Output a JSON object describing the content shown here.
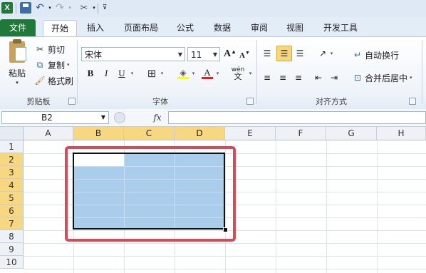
{
  "colors": {
    "file_tab_bg": "#1f7a3a",
    "selection_fill": "#aacdec",
    "selected_header": "#f7d77f",
    "highlight_frame": "#d94a57",
    "font_color_underline": "#e02020",
    "fill_color_underline": "#ffff00"
  },
  "quick_access": {
    "icons": [
      "excel-logo-icon",
      "save-icon",
      "undo-icon",
      "redo-icon",
      "format-painter-icon",
      "customize-icon"
    ],
    "logo_letter": "X"
  },
  "tabs": [
    {
      "label": "文件",
      "active": false
    },
    {
      "label": "开始",
      "active": true
    },
    {
      "label": "插入",
      "active": false
    },
    {
      "label": "页面布局",
      "active": false
    },
    {
      "label": "公式",
      "active": false
    },
    {
      "label": "数据",
      "active": false
    },
    {
      "label": "审阅",
      "active": false
    },
    {
      "label": "视图",
      "active": false
    },
    {
      "label": "开发工具",
      "active": false
    }
  ],
  "ribbon": {
    "clipboard": {
      "paste_label": "粘贴",
      "cut_label": "剪切",
      "copy_label": "复制",
      "format_painter_label": "格式刷",
      "group_label": "剪贴板"
    },
    "font": {
      "font_name": "宋体",
      "font_size": "11",
      "bold": "B",
      "italic": "I",
      "underline": "U",
      "grow_font": "A",
      "shrink_font": "A",
      "font_color_letter": "A",
      "wen_glyph": "wén",
      "group_label": "字体"
    },
    "alignment": {
      "wrap_text_label": "自动换行",
      "merge_center_label": "合并后居中",
      "group_label": "对齐方式"
    }
  },
  "formula_bar": {
    "name_box": "B2",
    "fx_label": "fx",
    "formula": ""
  },
  "sheet": {
    "columns": [
      "A",
      "B",
      "C",
      "D",
      "E",
      "F",
      "G",
      "H"
    ],
    "selected_columns": [
      "B",
      "C",
      "D"
    ],
    "rows": [
      "1",
      "2",
      "3",
      "4",
      "5",
      "6",
      "7",
      "8",
      "9",
      "10"
    ],
    "selected_rows": [
      "2",
      "3",
      "4",
      "5",
      "6",
      "7"
    ],
    "selection_range": "B2:D7",
    "active_cell": "B2"
  }
}
